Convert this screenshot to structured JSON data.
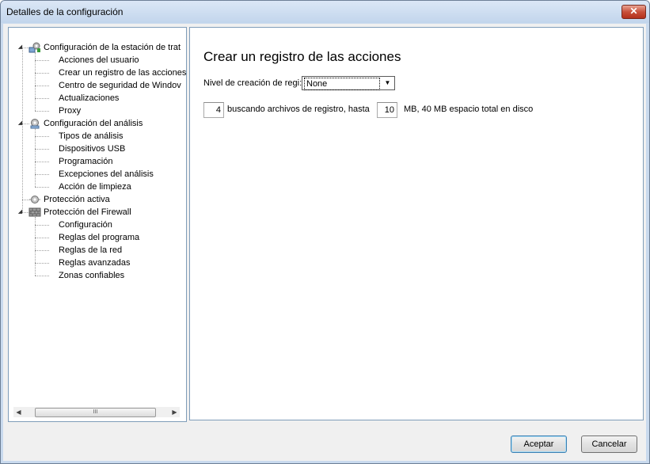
{
  "window": {
    "title": "Detalles de la configuración",
    "close_label": "✕"
  },
  "tree": {
    "groups": [
      {
        "label": "Configuración de la estación de trat",
        "icon": "workstation-gear-icon",
        "children": [
          "Acciones del usuario",
          "Crear un registro de las acciones",
          "Centro de seguridad de Windov",
          "Actualizaciones",
          "Proxy"
        ]
      },
      {
        "label": "Configuración del análisis",
        "icon": "scan-gear-icon",
        "children": [
          "Tipos de análisis",
          "Dispositivos USB",
          "Programación",
          "Excepciones del análisis",
          "Acción de limpieza"
        ]
      },
      {
        "label": "Protección activa",
        "icon": "shield-gear-icon",
        "children": []
      },
      {
        "label": "Protección del Firewall",
        "icon": "firewall-brick-icon",
        "children": [
          "Configuración",
          "Reglas del  programa",
          "Reglas de la red",
          "Reglas avanzadas",
          "Zonas confiables"
        ]
      }
    ],
    "scroll_thumb_label": "III"
  },
  "panel": {
    "title": "Crear un registro de las acciones",
    "level_label": "Nivel de creación de regi:",
    "level_value": "None",
    "files_count": "4",
    "files_text": "buscando archivos de registro, hasta",
    "size_value": "10",
    "size_text": "MB, 40 MB espacio total en disco"
  },
  "buttons": {
    "ok": "Aceptar",
    "cancel": "Cancelar"
  }
}
